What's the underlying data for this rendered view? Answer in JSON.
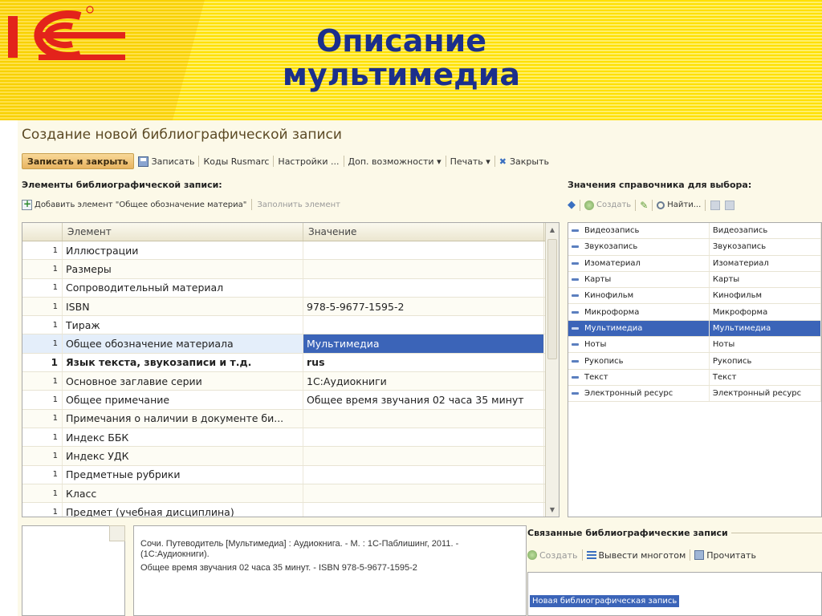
{
  "slide": {
    "title_line1": "Описание",
    "title_line2": "мультимедиа"
  },
  "window": {
    "title": "Создание новой библиографической записи",
    "toolbar": {
      "write_close": "Записать и закрыть",
      "write": "Записать",
      "rusmarc": "Коды Rusmarc",
      "settings": "Настройки ...",
      "extras": "Доп. возможности ▾",
      "print": "Печать ▾",
      "close": "Закрыть"
    }
  },
  "elements": {
    "section_title": "Элементы библиографической записи:",
    "add_label": "Добавить элемент \"Общее обозначение материа\"",
    "fill_label": "Заполнить элемент",
    "headers": {
      "element": "Элемент",
      "value": "Значение"
    },
    "rows": [
      {
        "n": "1",
        "element": "Иллюстрации",
        "value": ""
      },
      {
        "n": "1",
        "element": "Размеры",
        "value": ""
      },
      {
        "n": "1",
        "element": "Сопроводительный материал",
        "value": ""
      },
      {
        "n": "1",
        "element": "ISBN",
        "value": "978-5-9677-1595-2"
      },
      {
        "n": "1",
        "element": "Тираж",
        "value": ""
      },
      {
        "n": "1",
        "element": "Общее обозначение материала",
        "value": "Мультимедиа"
      },
      {
        "n": "1",
        "element": "Язык текста, звукозаписи и т.д.",
        "value": "rus"
      },
      {
        "n": "1",
        "element": "Основное заглавие серии",
        "value": "1С:Аудиокниги"
      },
      {
        "n": "1",
        "element": "Общее примечание",
        "value": "Общее время звучания 02 часа 35 минут"
      },
      {
        "n": "1",
        "element": "Примечания о наличии в документе би...",
        "value": ""
      },
      {
        "n": "1",
        "element": "Индекс ББК",
        "value": ""
      },
      {
        "n": "1",
        "element": "Индекс УДК",
        "value": ""
      },
      {
        "n": "1",
        "element": "Предметные рубрики",
        "value": ""
      },
      {
        "n": "1",
        "element": "Класс",
        "value": ""
      },
      {
        "n": "1",
        "element": "Предмет (учебная дисциплина)",
        "value": ""
      }
    ]
  },
  "directory": {
    "section_title": "Значения справочника для выбора:",
    "create": "Создать",
    "find": "Найти...",
    "rows": [
      {
        "c1": "Видеозапись",
        "c2": "Видеозапись"
      },
      {
        "c1": "Звукозапись",
        "c2": "Звукозапись"
      },
      {
        "c1": "Изоматериал",
        "c2": "Изоматериал"
      },
      {
        "c1": "Карты",
        "c2": "Карты"
      },
      {
        "c1": "Кинофильм",
        "c2": "Кинофильм"
      },
      {
        "c1": "Микроформа",
        "c2": "Микроформа"
      },
      {
        "c1": "Мультимедиа",
        "c2": "Мультимедиа"
      },
      {
        "c1": "Ноты",
        "c2": "Ноты"
      },
      {
        "c1": "Рукопись",
        "c2": "Рукопись"
      },
      {
        "c1": "Текст",
        "c2": "Текст"
      },
      {
        "c1": "Электронный ресурс",
        "c2": "Электронный ресурс"
      }
    ]
  },
  "description": {
    "line1": "Сочи. Путеводитель [Мультимедиа] : Аудиокнига. - М. : 1С-Паблишинг, 2011. - (1С:Аудиокниги).",
    "line2": "Общее время звучания 02 часа 35 минут. - ISBN 978-5-9677-1595-2"
  },
  "related": {
    "section_title": "Связанные библиографические записи",
    "create": "Создать",
    "output": "Вывести многотом",
    "read": "Прочитать",
    "item": "Новая библиографическая запись"
  },
  "colors": {
    "banner": "#f8d100",
    "logo_red": "#e3231b",
    "title_blue": "#1b2f8c",
    "selection": "#3b64b8"
  }
}
